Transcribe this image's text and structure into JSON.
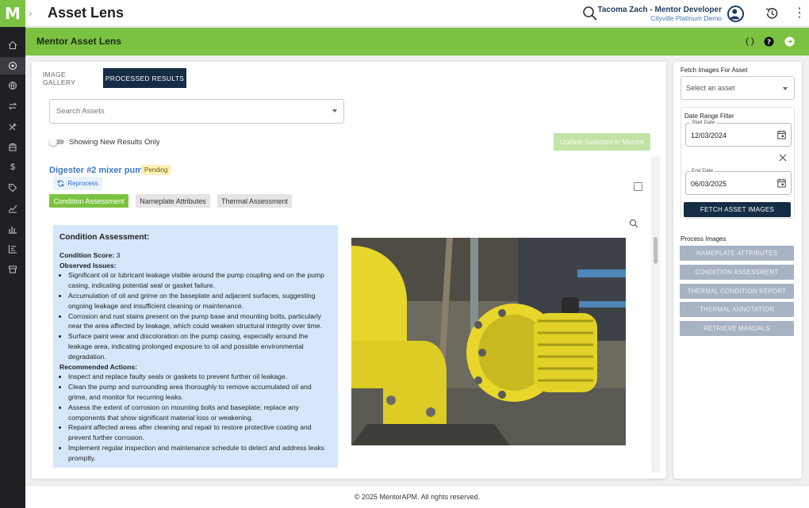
{
  "app": {
    "logo": "M",
    "title": "Asset Lens"
  },
  "user": {
    "name": "Tacoma Zach - Mentor Developer",
    "org": "Cityville Platinum Demo"
  },
  "module": {
    "title": "Mentor Asset Lens"
  },
  "tabs": [
    {
      "label": "IMAGE GALLERY",
      "active": false
    },
    {
      "label": "PROCESSED RESULTS",
      "active": true
    }
  ],
  "search": {
    "placeholder": "Search Assets"
  },
  "toggle": {
    "label": "Showing New Results Only",
    "on": false
  },
  "update_button": "Update Selected in Mentor",
  "asset": {
    "name": "Digester #2 mixer pump",
    "status": "Pending",
    "reprocess": "Reprocess",
    "chips": [
      "Condition Assessment",
      "Nameplate Attributes",
      "Thermal Assessment"
    ]
  },
  "assessment": {
    "heading": "Condition Assessment:",
    "score_label": "Condition Score:",
    "score_value": "3",
    "issues_heading": "Observed Issues:",
    "issues": [
      "Significant oil or lubricant leakage visible around the pump coupling and on the pump casing, indicating potential seal or gasket failure.",
      "Accumulation of oil and grime on the baseplate and adjacent surfaces, suggesting ongoing leakage and insufficient cleaning or maintenance.",
      "Corrosion and rust stains present on the pump base and mounting bolts, particularly near the area affected by leakage, which could weaken structural integrity over time.",
      "Surface paint wear and discoloration on the pump casing, especially around the leakage area, indicating prolonged exposure to oil and possible environmental degradation."
    ],
    "actions_heading": "Recommended Actions:",
    "actions": [
      "Inspect and replace faulty seals or gaskets to prevent further oil leakage.",
      "Clean the pump and surrounding area thoroughly to remove accumulated oil and grime, and monitor for recurring leaks.",
      "Assess the extent of corrosion on mounting bolts and baseplate; replace any components that show significant material loss or weakening.",
      "Repaint affected areas after cleaning and repair to restore protective coating and prevent further corrosion.",
      "Implement regular inspection and maintenance schedule to detect and address leaks promptly."
    ]
  },
  "sidebar": {
    "fetch_label": "Fetch Images For Asset",
    "asset_select": "Select an asset",
    "date_filter_label": "Date Range Filter",
    "start_label": "Start Date",
    "start_value": "12/03/2024",
    "end_label": "End Date",
    "end_value": "06/03/2025",
    "fetch_button": "FETCH ASSET IMAGES",
    "process_label": "Process Images",
    "process_buttons": [
      "NAMEPLATE ATTRIBUTES",
      "CONDITION ASSESSMENT",
      "THERMAL CONDITION REPORT",
      "THERMAL ANNOTATION",
      "RETRIEVE MANUALS"
    ]
  },
  "footer": "© 2025 MentorAPM. All rights reserved.",
  "colors": {
    "brand_green": "#7cc242",
    "navy": "#142c45",
    "rail": "#1f2024",
    "link_blue": "#3a78c7",
    "disabled_button": "#a7b3c2"
  }
}
